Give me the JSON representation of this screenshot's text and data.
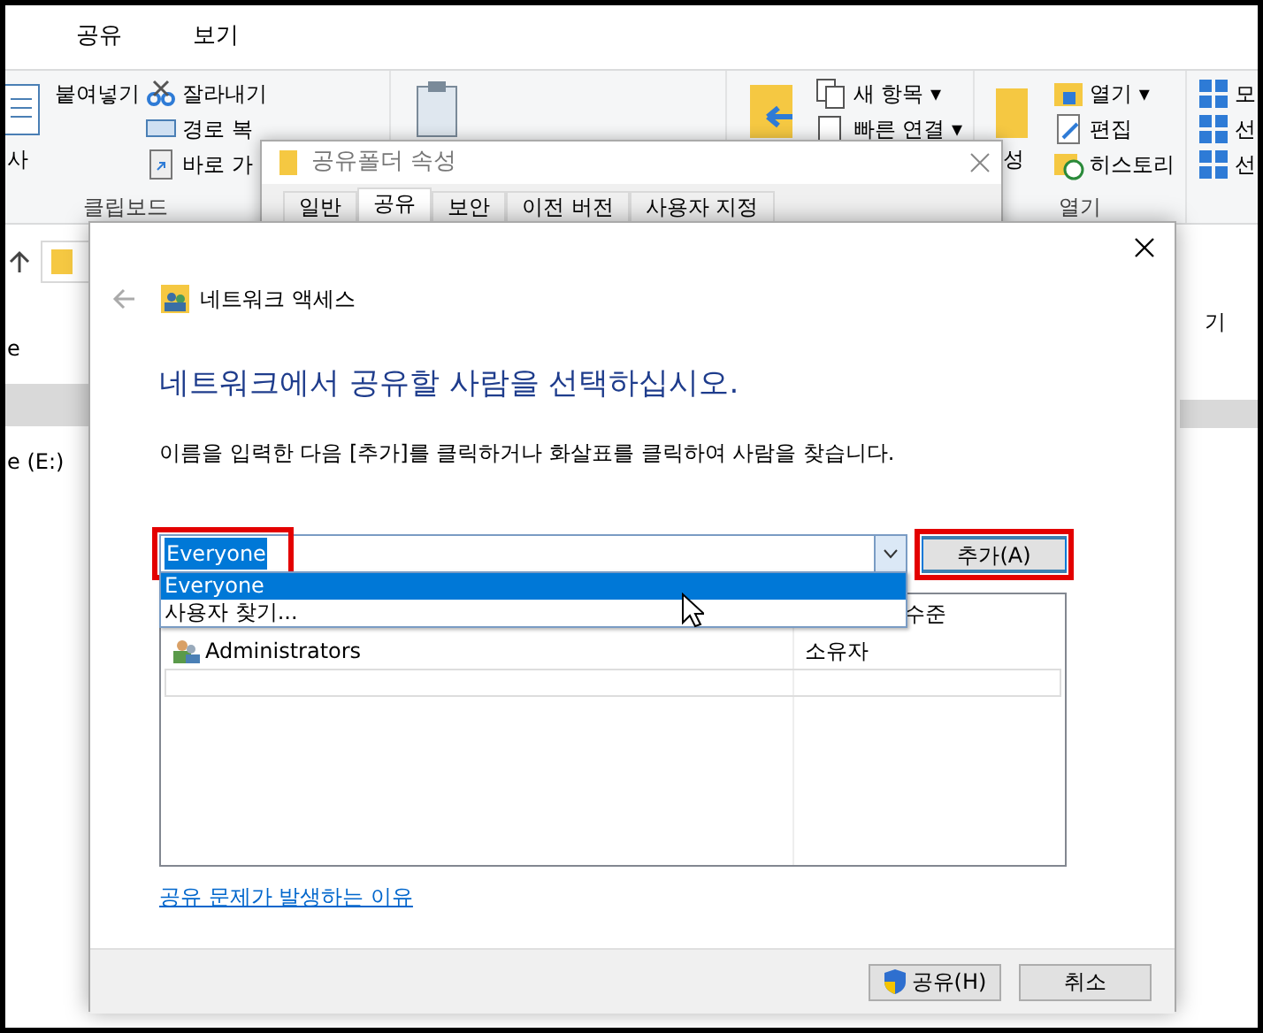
{
  "explorer": {
    "ribbon_tabs": [
      {
        "label": "공유"
      },
      {
        "label": "보기"
      }
    ],
    "ribbon_groups": [
      {
        "label": "클립보드",
        "columns": [
          {
            "kind": "large",
            "label": "사"
          },
          {
            "kind": "large",
            "label": "붙여넣기"
          },
          {
            "kind": "stack",
            "items": [
              {
                "label": "잘라내기"
              },
              {
                "label": "경로 복"
              },
              {
                "label": "바로 가"
              }
            ]
          }
        ]
      },
      {
        "columns": [
          {
            "kind": "large"
          },
          {
            "kind": "large"
          },
          {
            "kind": "large"
          },
          {
            "kind": "large"
          }
        ]
      },
      {
        "columns": [
          {
            "kind": "large"
          },
          {
            "kind": "stack",
            "items": [
              {
                "label": "새 항목 ▾"
              },
              {
                "label": "빠른 연결 ▾"
              }
            ]
          }
        ]
      },
      {
        "label": "열기",
        "columns": [
          {
            "kind": "large",
            "label": "성"
          },
          {
            "kind": "stack",
            "items": [
              {
                "label": "열기 ▾"
              },
              {
                "label": "편집"
              },
              {
                "label": "히스토리"
              }
            ]
          }
        ]
      },
      {
        "columns": [
          {
            "kind": "stack",
            "items": [
              {
                "label": "모"
              },
              {
                "label": "선"
              },
              {
                "label": "선"
              }
            ]
          }
        ]
      }
    ],
    "sidebar": [
      {
        "label": "e",
        "selected": false
      },
      {
        "selected": true
      },
      {
        "label": "e (E:)",
        "selected": false
      }
    ],
    "content_header": "기"
  },
  "properties_window": {
    "title": "공유폴더 속성",
    "tabs": [
      {
        "label": "일반",
        "selected": false
      },
      {
        "label": "공유",
        "selected": true
      },
      {
        "label": "보안",
        "selected": false
      },
      {
        "label": "이전 버전",
        "selected": false
      },
      {
        "label": "사용자 지정",
        "selected": false
      }
    ]
  },
  "dialog": {
    "nav_title": "네트워크 액세스",
    "heading": "네트워크에서 공유할 사람을 선택하십시오.",
    "instruction": "이름을 입력한 다음 [추가]를 클릭하거나 화살표를 클릭하여 사람을 찾습니다.",
    "name_field": {
      "value": "Everyone",
      "highlighted": true,
      "expanded": true
    },
    "dropdown_options": [
      {
        "label": "Everyone",
        "selected": true
      },
      {
        "label": "사용자 찾기...",
        "selected": false
      }
    ],
    "add_button": {
      "label": "추가(A)",
      "highlighted": true
    },
    "table": {
      "column_2_header": "수준",
      "rows": [
        {
          "name": "Administrators",
          "permission": "소유자"
        }
      ]
    },
    "link": "공유 문제가 발생하는 이유",
    "buttons": [
      {
        "label": "공유(H)",
        "kind": "shield"
      },
      {
        "label": "취소",
        "kind": "plain"
      }
    ]
  }
}
